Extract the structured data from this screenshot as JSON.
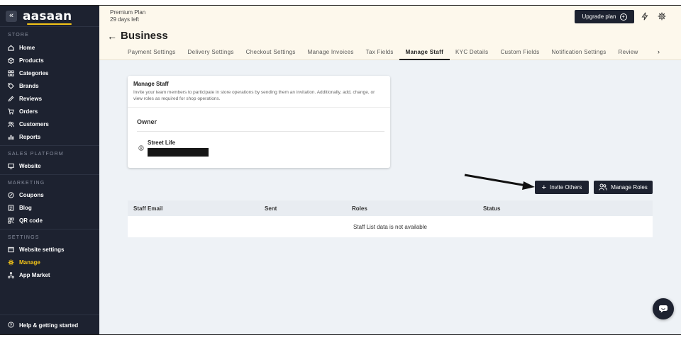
{
  "sidebar": {
    "logo": "aasaan",
    "collapse_icon": "«",
    "sections": [
      {
        "label": "STORE",
        "items": [
          {
            "label": "Home",
            "icon": "home-icon"
          },
          {
            "label": "Products",
            "icon": "box-icon"
          },
          {
            "label": "Categories",
            "icon": "grid-icon"
          },
          {
            "label": "Brands",
            "icon": "tag-icon"
          },
          {
            "label": "Reviews",
            "icon": "pen-icon"
          },
          {
            "label": "Orders",
            "icon": "cart-icon"
          },
          {
            "label": "Customers",
            "icon": "users-icon"
          },
          {
            "label": "Reports",
            "icon": "bar-chart-icon"
          }
        ]
      },
      {
        "label": "SALES PLATFORM",
        "items": [
          {
            "label": "Website",
            "icon": "monitor-icon"
          }
        ]
      },
      {
        "label": "MARKETING",
        "items": [
          {
            "label": "Coupons",
            "icon": "coupon-icon"
          },
          {
            "label": "Blog",
            "icon": "document-icon"
          },
          {
            "label": "QR code",
            "icon": "qr-icon"
          }
        ]
      },
      {
        "label": "SETTINGS",
        "items": [
          {
            "label": "Website settings",
            "icon": "browser-icon"
          },
          {
            "label": "Manage",
            "icon": "gear-icon",
            "active": true
          },
          {
            "label": "App Market",
            "icon": "apps-icon"
          }
        ]
      }
    ],
    "help": "Help & getting started"
  },
  "header": {
    "plan_name": "Premium Plan",
    "plan_days": "29 days left",
    "upgrade_label": "Upgrade plan",
    "title": "Business",
    "tabs": [
      {
        "label": "Payment Settings"
      },
      {
        "label": "Delivery Settings"
      },
      {
        "label": "Checkout Settings"
      },
      {
        "label": "Manage Invoices"
      },
      {
        "label": "Tax Fields"
      },
      {
        "label": "Manage Staff",
        "active": true
      },
      {
        "label": "KYC Details"
      },
      {
        "label": "Custom Fields"
      },
      {
        "label": "Notification Settings"
      },
      {
        "label": "Review"
      }
    ]
  },
  "staff_card": {
    "title": "Manage Staff",
    "description": "Invite your team members to participate in store operations by sending them an invitation. Additionally, add, change, or view roles as required for shop operations.",
    "owner_label": "Owner",
    "owner_name": "Street Life"
  },
  "actions": {
    "invite_label": "Invite Others",
    "roles_label": "Manage Roles"
  },
  "staff_table": {
    "columns": [
      "Staff Email",
      "Sent",
      "Roles",
      "Status"
    ],
    "empty_message": "Staff List data is not available"
  },
  "colors": {
    "sidebar_bg": "#1d2230",
    "accent": "#f5c518",
    "header_bg": "#fdf8ec",
    "main_bg": "#eef2f6"
  }
}
